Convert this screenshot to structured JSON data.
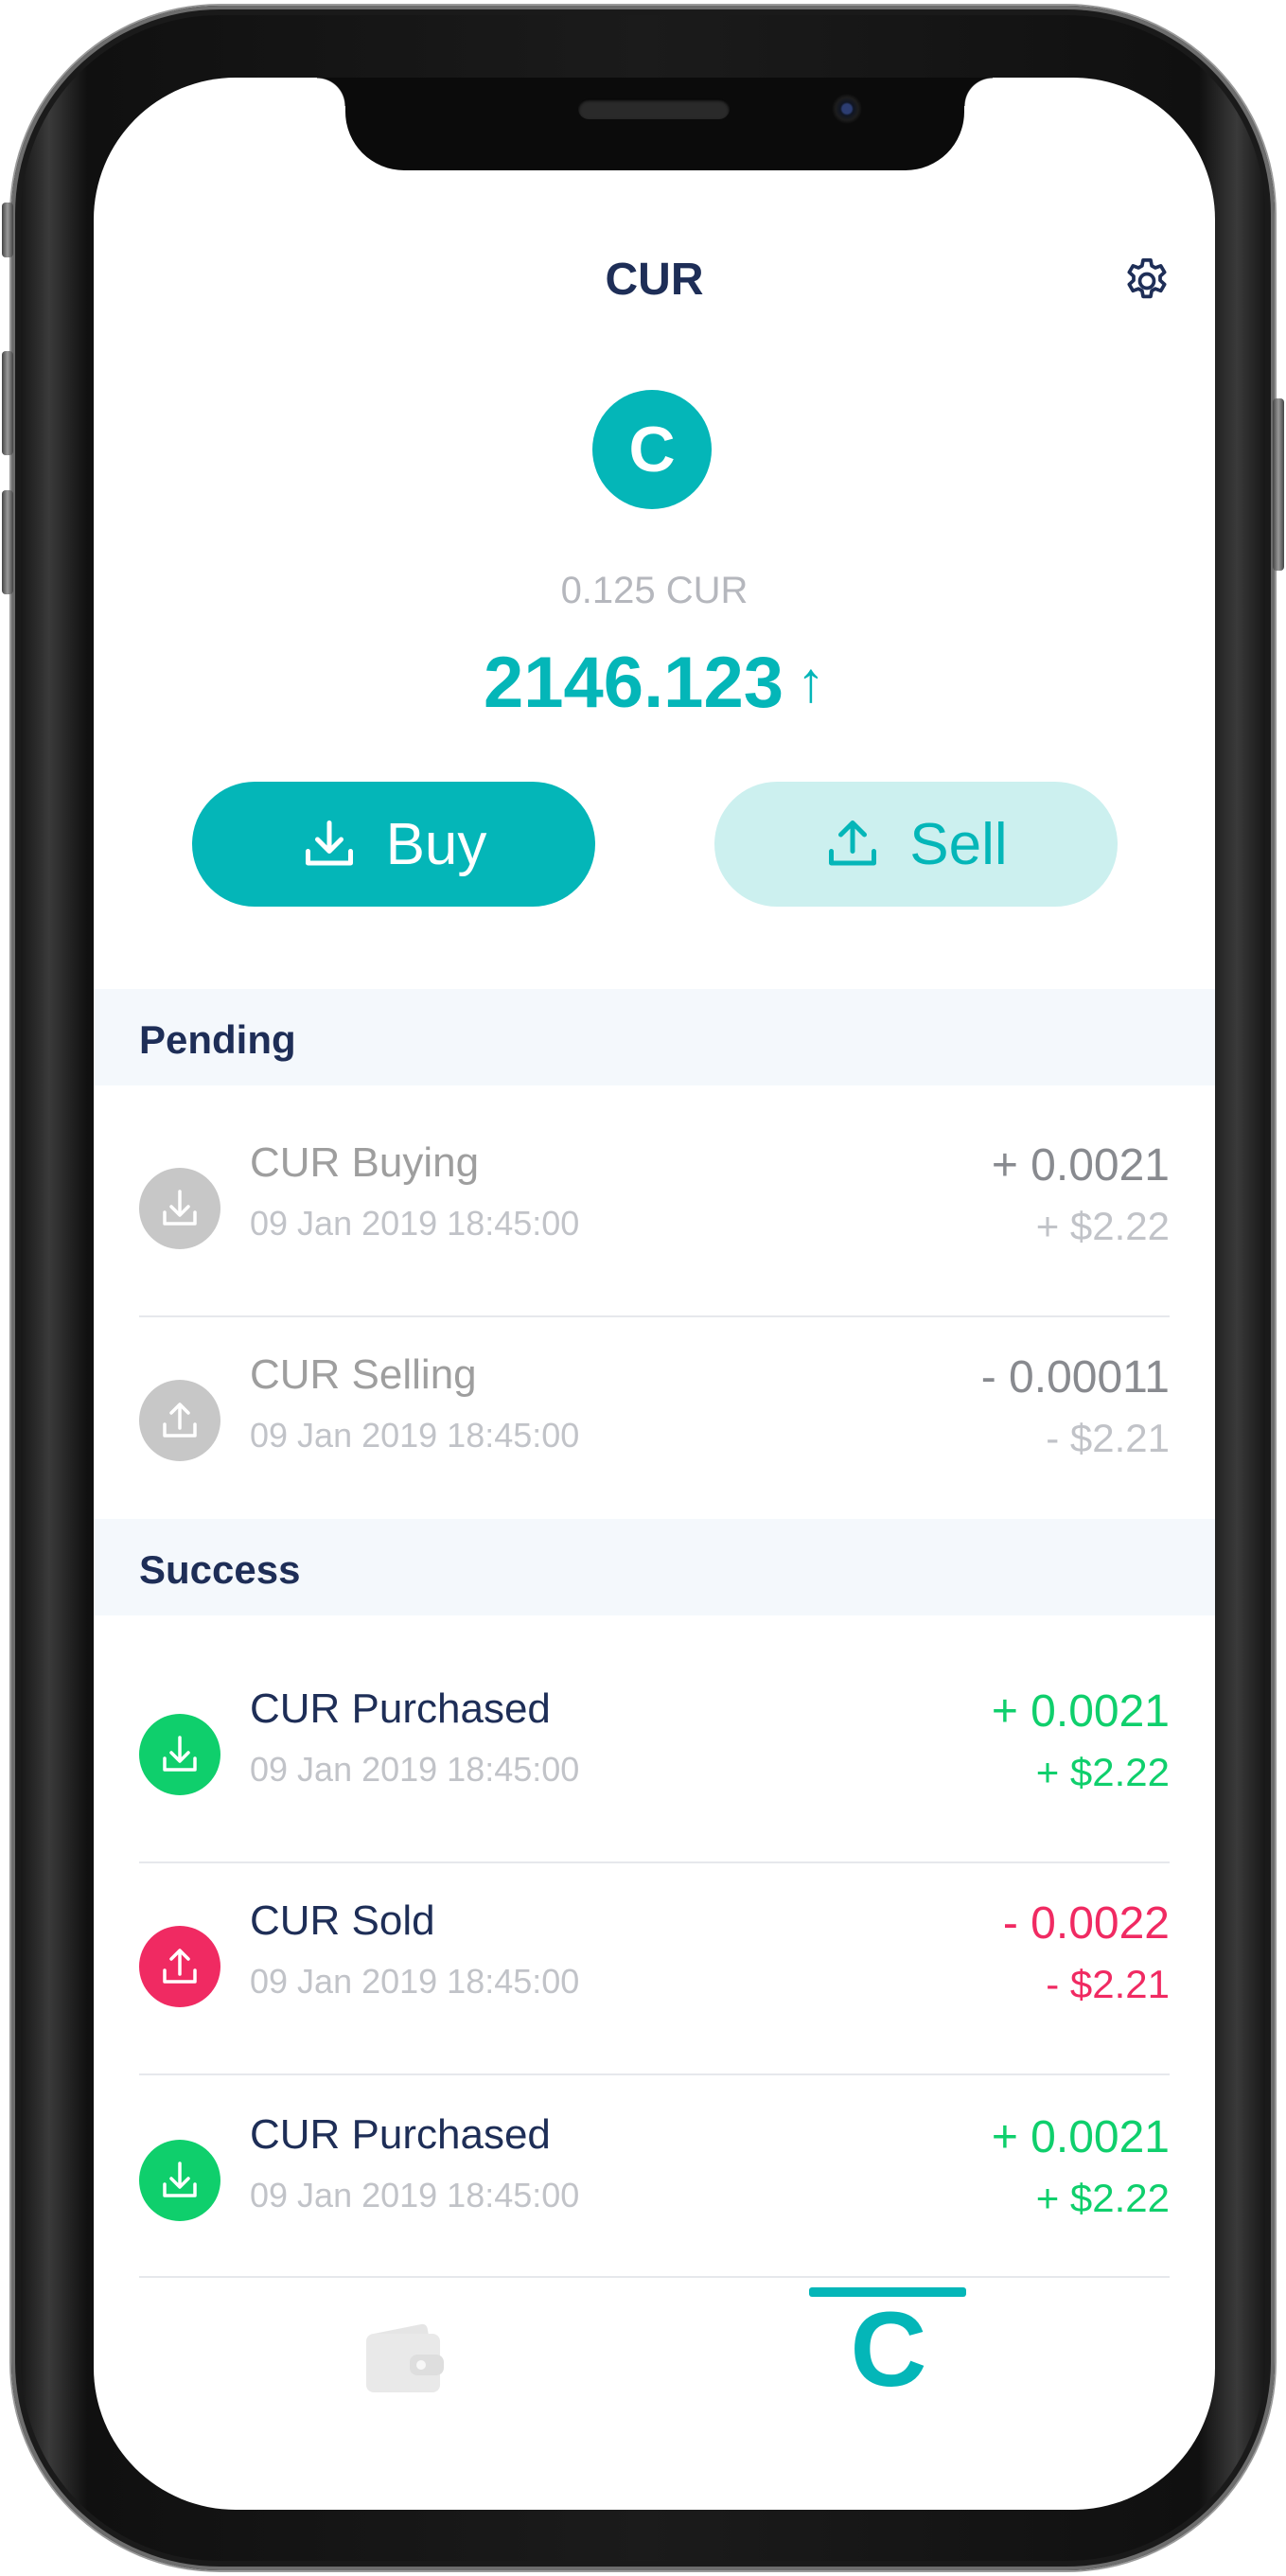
{
  "header": {
    "title": "CUR",
    "settings_icon": "gear-icon"
  },
  "coin": {
    "letter": "C",
    "color": "#04b6b8"
  },
  "balance": {
    "sub": "0.125 CUR",
    "value": "2146.123",
    "trend_icon": "↑"
  },
  "actions": {
    "buy_label": "Buy",
    "sell_label": "Sell"
  },
  "sections": {
    "pending": "Pending",
    "success": "Success"
  },
  "pending": [
    {
      "name": "CUR Buying",
      "date": "09 Jan 2019 18:45:00",
      "amount": "+ 0.0021",
      "usd": "+ $2.22",
      "icon": "download-icon"
    },
    {
      "name": "CUR Selling",
      "date": "09 Jan 2019 18:45:00",
      "amount": "- 0.00011",
      "usd": "- $2.21",
      "icon": "upload-icon"
    }
  ],
  "success": [
    {
      "name": "CUR Purchased",
      "date": "09 Jan 2019 18:45:00",
      "amount": "+ 0.0021",
      "usd": "+ $2.22",
      "icon": "download-icon"
    },
    {
      "name": "CUR Sold",
      "date": "09 Jan 2019 18:45:00",
      "amount": "- 0.0022",
      "usd": "- $2.21",
      "icon": "upload-icon"
    },
    {
      "name": "CUR Purchased",
      "date": "09 Jan 2019 18:45:00",
      "amount": "+ 0.0021",
      "usd": "+ $2.22",
      "icon": "download-icon"
    }
  ],
  "colors": {
    "accent": "#04b6b8",
    "pending": "#9e9e9e",
    "positive": "#0fcf6c",
    "negative": "#f02a62",
    "navy": "#1e2e57"
  },
  "tabbar": {
    "wallet_icon": "wallet-icon",
    "coin_tab_label": "C"
  }
}
